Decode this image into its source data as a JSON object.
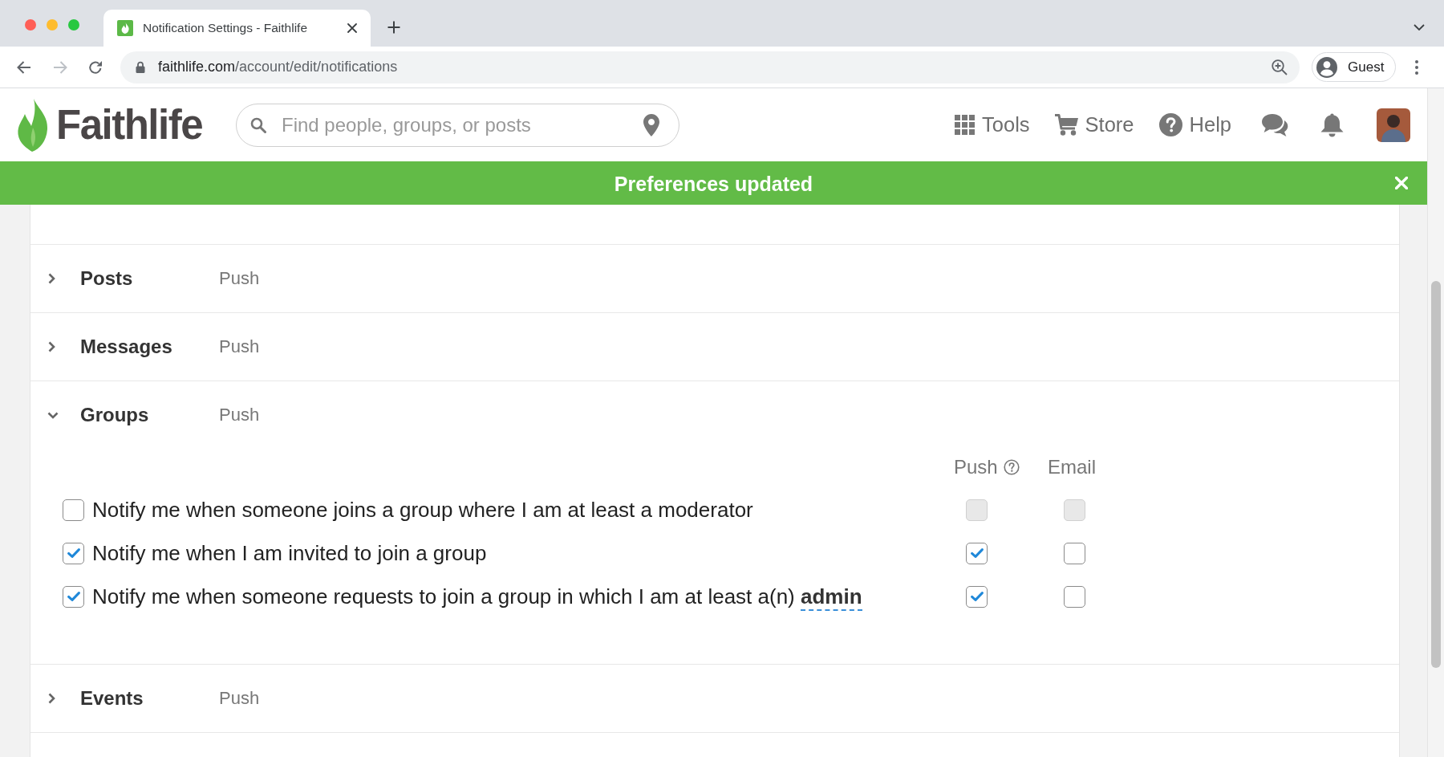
{
  "browser": {
    "tabs": [
      {
        "title": "Notification Settings - Faithlife",
        "selected": true
      }
    ],
    "url": {
      "host": "faithlife.com",
      "path": "/account/edit/notifications"
    },
    "profile": "Guest"
  },
  "header": {
    "logo": "Faithlife",
    "search": {
      "placeholder": "Find people, groups, or posts"
    },
    "nav": [
      {
        "kind": "tools",
        "label": "Tools"
      },
      {
        "kind": "store",
        "label": "Store"
      },
      {
        "kind": "help",
        "label": "Help"
      },
      {
        "kind": "messages"
      },
      {
        "kind": "notifications"
      },
      {
        "kind": "avatar"
      }
    ]
  },
  "banner": {
    "message": "Preferences updated"
  },
  "sections": [
    {
      "title": "Posts",
      "summary": "Push",
      "expanded": false
    },
    {
      "title": "Messages",
      "summary": "Push",
      "expanded": false
    },
    {
      "title": "Groups",
      "summary": "Push",
      "expanded": true,
      "columns": [
        {
          "label": "Push",
          "help": true
        },
        {
          "label": "Email",
          "help": false
        }
      ],
      "items": [
        {
          "text": "Notify me when someone joins a group where I am at least a moderator",
          "checked": false,
          "channels": [
            {
              "checked": false,
              "disabled": true
            },
            {
              "checked": false,
              "disabled": true
            }
          ]
        },
        {
          "text": "Notify me when I am invited to join a group",
          "checked": true,
          "channels": [
            {
              "checked": true,
              "disabled": false
            },
            {
              "checked": false,
              "disabled": false
            }
          ]
        },
        {
          "text": "Notify me when someone requests to join a group in which I am at least a(n)",
          "link": "admin",
          "checked": true,
          "channels": [
            {
              "checked": true,
              "disabled": false
            },
            {
              "checked": false,
              "disabled": false
            }
          ]
        }
      ]
    },
    {
      "title": "Events",
      "summary": "Push",
      "expanded": false
    }
  ]
}
